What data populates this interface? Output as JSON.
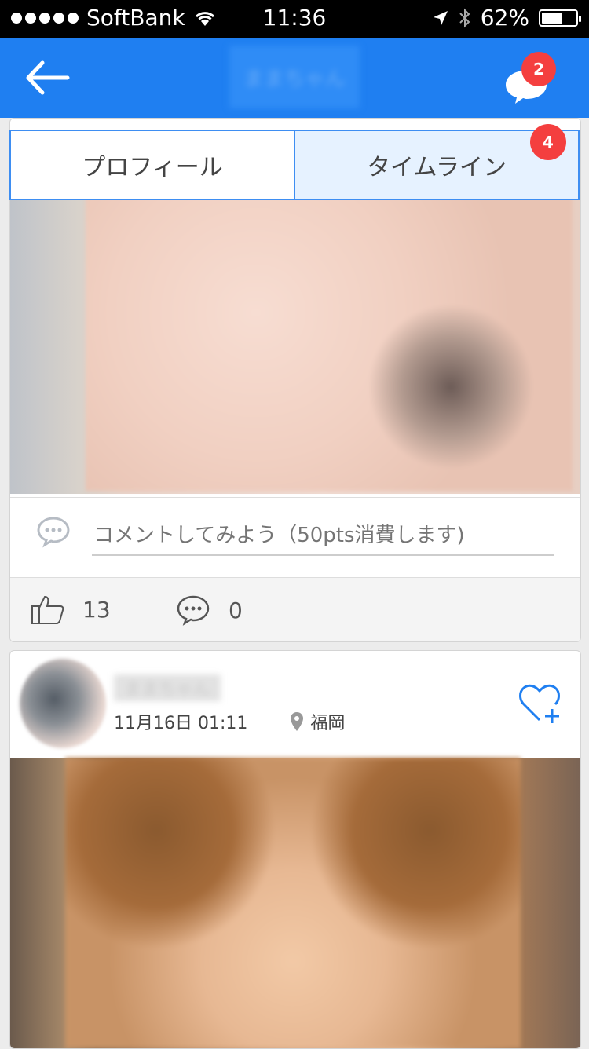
{
  "status_bar": {
    "carrier": "SoftBank",
    "time": "11:36",
    "battery": "62%",
    "battery_level": 0.62
  },
  "nav": {
    "title": "ままちゃん",
    "messages_badge": "2"
  },
  "tabs": {
    "profile": "プロフィール",
    "timeline": "タイムライン",
    "timeline_badge": "4"
  },
  "post1": {
    "comment_placeholder": "コメントしてみよう（50pts消費します)",
    "likes": "13",
    "comments": "0"
  },
  "post2": {
    "username": "ままちゃん",
    "datetime": "11月16日 01:11",
    "location": "福岡"
  },
  "colors": {
    "accent": "#1f7ff1",
    "badge": "#f43f3f"
  }
}
